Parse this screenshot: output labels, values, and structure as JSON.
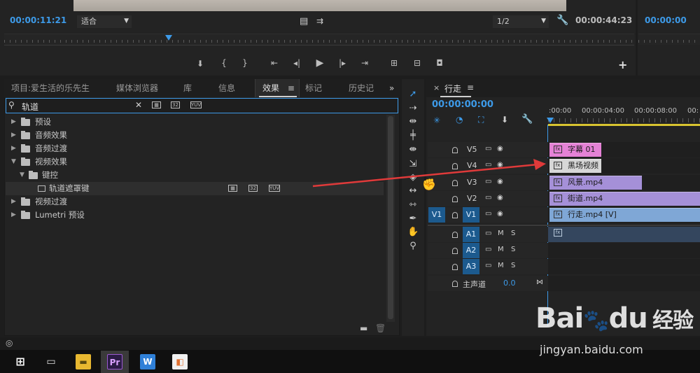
{
  "monitor": {
    "timecode_left": "00:00:11:21",
    "fit_option": "适合",
    "resolution": "1/2",
    "duration": "00:00:44:23",
    "program_timecode": "00:00:00"
  },
  "panel_tabs": [
    {
      "label": "项目:爱生活的乐先生",
      "active": false
    },
    {
      "label": "媒体浏览器",
      "active": false
    },
    {
      "label": "库",
      "active": false
    },
    {
      "label": "信息",
      "active": false
    },
    {
      "label": "效果",
      "active": true
    },
    {
      "label": "标记",
      "active": false
    },
    {
      "label": "历史记",
      "active": false
    }
  ],
  "effects": {
    "search_value": "轨道",
    "tree": [
      {
        "label": "预设",
        "expanded": false
      },
      {
        "label": "音频效果",
        "expanded": false
      },
      {
        "label": "音频过渡",
        "expanded": false
      },
      {
        "label": "视频效果",
        "expanded": true
      },
      {
        "label": "键控",
        "expanded": true
      },
      {
        "label": "轨道遮罩键",
        "expanded": false
      },
      {
        "label": "视频过渡",
        "expanded": false
      },
      {
        "label": "Lumetri 预设",
        "expanded": false
      }
    ],
    "filter_icons": [
      "32",
      "YUV"
    ]
  },
  "timeline": {
    "sequence_name": "行走",
    "timecode": "00:00:00:00",
    "ruler_labels": [
      ":00:00",
      "00:00:04:00",
      "00:00:08:00",
      "00:"
    ],
    "video_tracks": [
      {
        "name": "V5"
      },
      {
        "name": "V4"
      },
      {
        "name": "V3"
      },
      {
        "name": "V2"
      },
      {
        "name": "V1",
        "source": "V1"
      }
    ],
    "audio_tracks": [
      {
        "name": "A1"
      },
      {
        "name": "A2"
      },
      {
        "name": "A3"
      }
    ],
    "audio_buttons": {
      "mute": "M",
      "solo": "S"
    },
    "master": {
      "label": "主声道",
      "value": "0.0"
    },
    "clips": [
      {
        "label": "字幕 01",
        "color": "#e582d6"
      },
      {
        "label": "黑场视频",
        "color": "#d7d7d7"
      },
      {
        "label": "风景.mp4",
        "color": "#a590d8"
      },
      {
        "label": "街道.mp4",
        "color": "#a590d8"
      },
      {
        "label": "行走.mp4 [V]",
        "color": "#7fa7d6"
      }
    ]
  },
  "taskbar": {
    "items": [
      "windows-start",
      "task-view",
      "file-explorer",
      "Pr",
      "W",
      "photo-app"
    ]
  },
  "watermark": {
    "brand": "Bai",
    "brand2": "du",
    "cn": "经验",
    "url": "jingyan.baidu.com"
  },
  "colors": {
    "accent_blue": "#3d9ae8",
    "arrow_red": "#e03a3a"
  }
}
